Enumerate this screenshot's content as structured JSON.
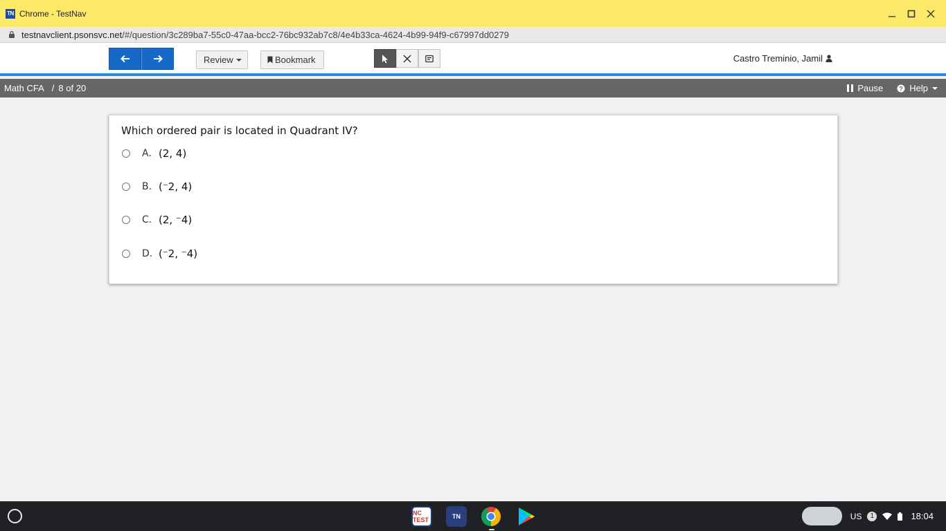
{
  "window": {
    "app_icon_text": "TN",
    "title": "Chrome - TestNav",
    "controls": [
      "minimize-icon",
      "maximize-icon",
      "close-icon"
    ]
  },
  "address_bar": {
    "host": "testnavclient.psonsvc.net",
    "path": "/#/question/3c289ba7-55c0-47aa-bcc2-76bc932ab7c8/4e4b33ca-4624-4b99-94f9-c67997dd0279"
  },
  "toolbar": {
    "back_icon": "arrow-left-icon",
    "next_icon": "arrow-right-icon",
    "review_label": "Review",
    "bookmark_label": "Bookmark",
    "tools": [
      "pointer-icon",
      "answer-eliminator-icon",
      "notepad-icon"
    ],
    "user_name": "Castro Treminio, Jamil"
  },
  "breadcrumb": {
    "test_name": "Math CFA",
    "separator": "/",
    "position": "8 of 20",
    "pause_label": "Pause",
    "help_label": "Help"
  },
  "question": {
    "prompt": "Which ordered pair is located in Quadrant IV?",
    "options": [
      {
        "letter": "A.",
        "text": "(2, 4)"
      },
      {
        "letter": "B.",
        "text": "(⁻2, 4)"
      },
      {
        "letter": "C.",
        "text": "(2, ⁻4)"
      },
      {
        "letter": "D.",
        "text": "(⁻2, ⁻4)"
      }
    ]
  },
  "shelf": {
    "apps": [
      {
        "name": "nc-test-app",
        "label": "NC TEST"
      },
      {
        "name": "testnav-app",
        "label": "TN"
      },
      {
        "name": "chrome-app",
        "label": ""
      },
      {
        "name": "play-store-app",
        "label": ""
      }
    ],
    "keyboard_layout": "US",
    "notification_count": "1",
    "time": "18:04"
  },
  "colors": {
    "titlebar": "#fce96a",
    "nav_button": "#1769c7",
    "accent_line": "#2c8ad8",
    "breadcrumb_bar": "#666666",
    "shelf": "#202124"
  }
}
